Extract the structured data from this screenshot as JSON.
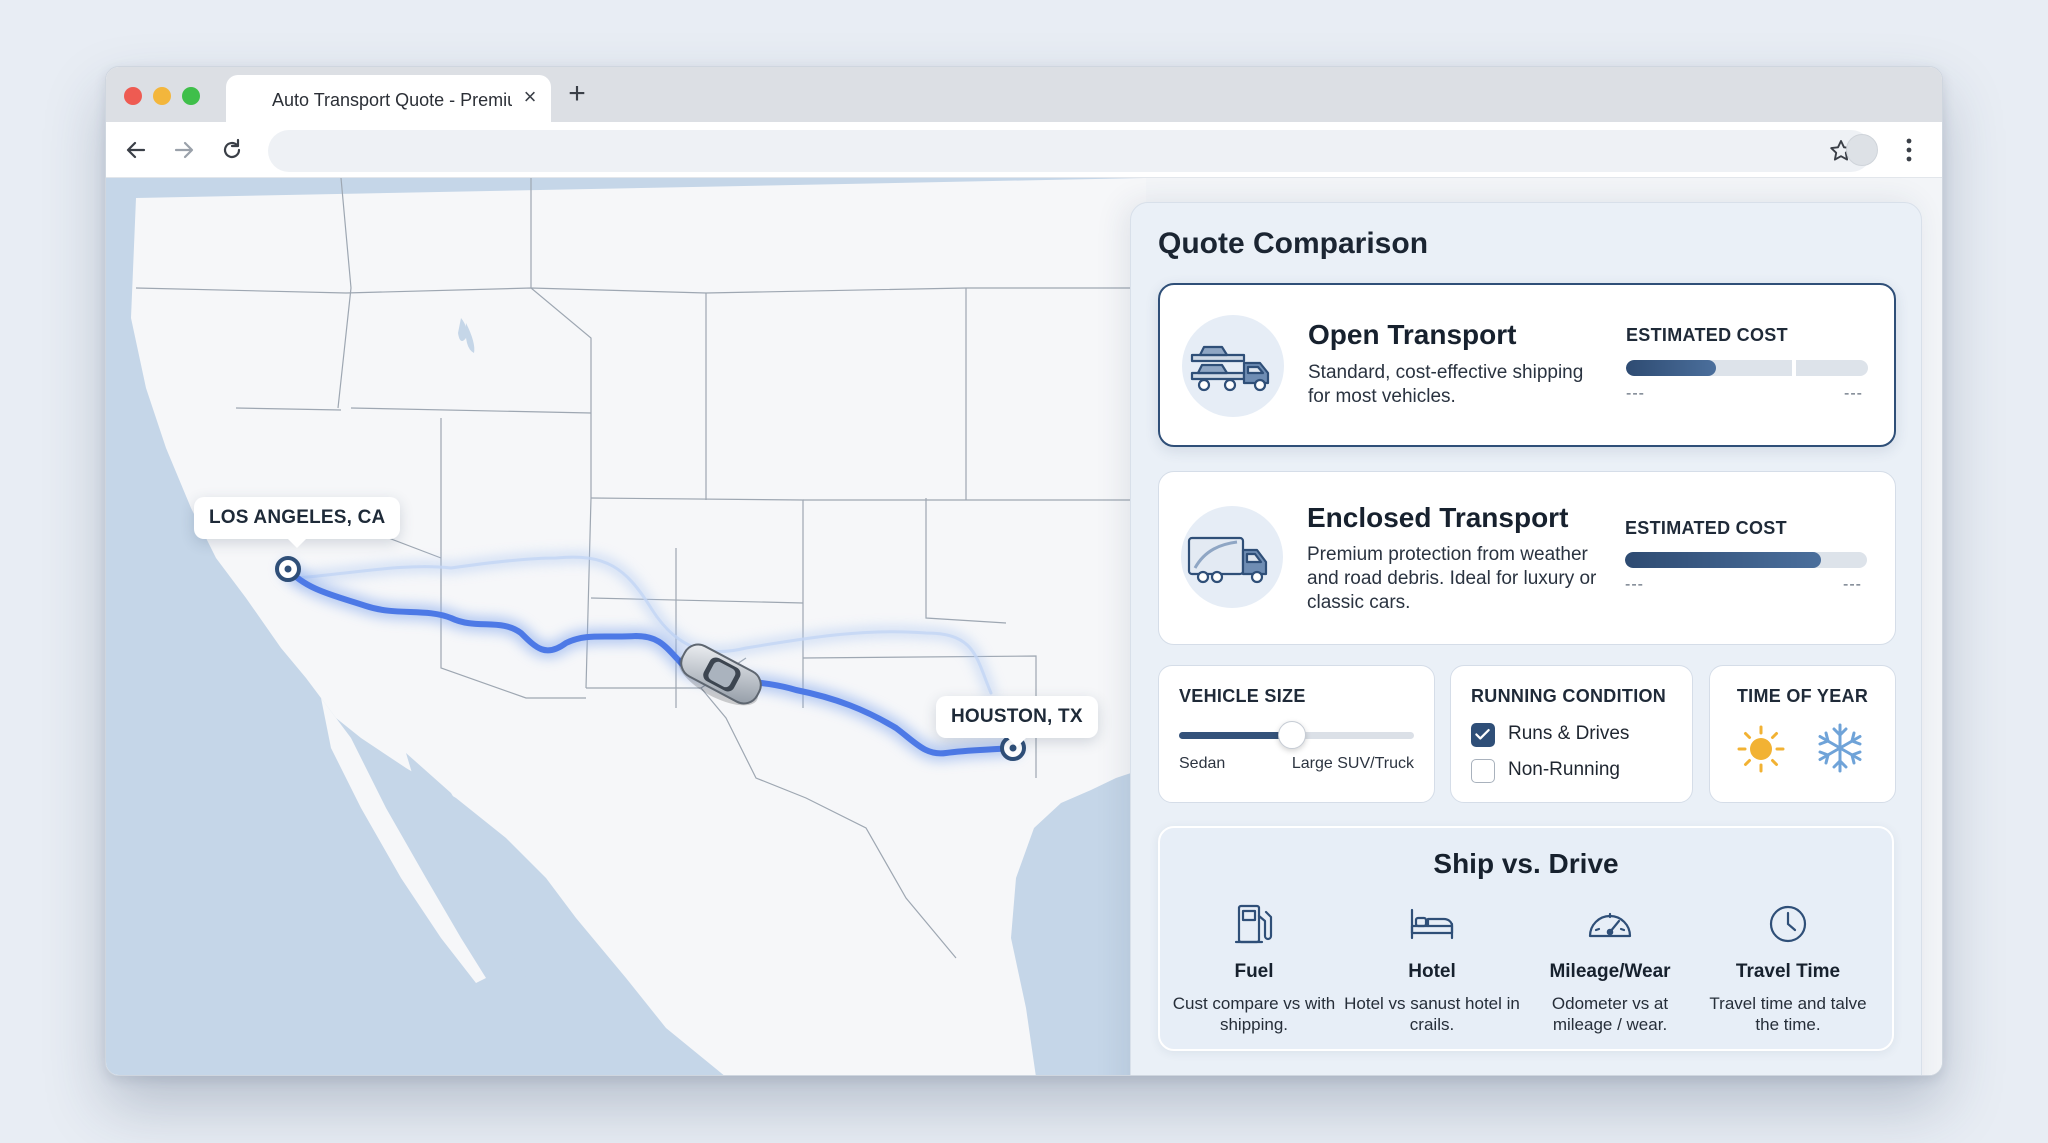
{
  "browser": {
    "tab_title": "Auto Transport Quote - Premium",
    "tab_close": "×",
    "new_tab": "+"
  },
  "map": {
    "origin_label": "LOS ANGELES, CA",
    "destination_label": "HOUSTON, TX",
    "route_color": "#4d79e6",
    "water_color": "#c5d6e8",
    "land_color": "#f6f7f9"
  },
  "panel": {
    "title": "Quote Comparison",
    "options": [
      {
        "title": "Open Transport",
        "description": "Standard, cost-effective shipping for most vehicles.",
        "cost_label": "ESTIMATED COST",
        "range_low": "---",
        "range_high": "---",
        "cost_fill_fraction": 0.37,
        "selected": true
      },
      {
        "title": "Enclosed Transport",
        "description": "Premium protection from weather and road debris. Ideal for luxury or classic cars.",
        "cost_label": "ESTIMATED COST",
        "range_low": "---",
        "range_high": "---",
        "cost_fill_fraction": 0.81,
        "selected": false
      }
    ],
    "vehicle_size": {
      "title": "VEHICLE SIZE",
      "min_label": "Sedan",
      "max_label": "Large SUV/Truck",
      "value_fraction": 0.48
    },
    "running_condition": {
      "title": "RUNNING CONDITION",
      "options": [
        {
          "label": "Runs & Drives",
          "checked": true
        },
        {
          "label": "Non-Running",
          "checked": false
        }
      ]
    },
    "time_of_year": {
      "title": "TIME OF YEAR",
      "icons": [
        "sun-icon",
        "snowflake-icon"
      ]
    },
    "ship_vs_drive": {
      "title": "Ship vs. Drive",
      "items": [
        {
          "icon": "fuel-pump-icon",
          "label": "Fuel",
          "description": "Cust compare vs with shipping."
        },
        {
          "icon": "bed-icon",
          "label": "Hotel",
          "description": "Hotel vs sanust hotel in crails."
        },
        {
          "icon": "speedometer-icon",
          "label": "Mileage/Wear",
          "description": "Odometer vs at mileage / wear."
        },
        {
          "icon": "clock-icon",
          "label": "Travel Time",
          "description": "Travel time and talve the time."
        }
      ]
    }
  },
  "colors": {
    "accent": "#2f4f78",
    "sun": "#f2b233",
    "snow": "#6fa3d8"
  }
}
